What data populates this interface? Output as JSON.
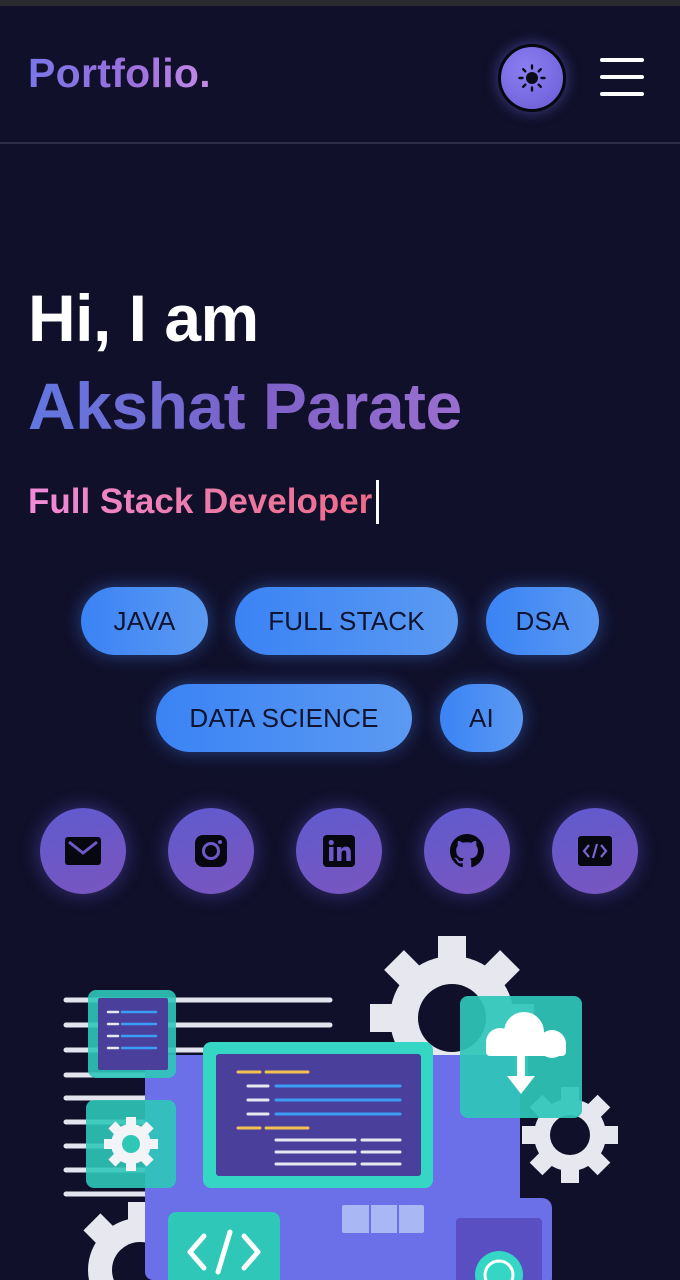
{
  "header": {
    "logo": "Portfolio.",
    "theme_toggle_icon": "sun-icon",
    "menu_icon": "hamburger-menu-icon"
  },
  "hero": {
    "greeting": "Hi, I am",
    "name": "Akshat Parate",
    "role": "Full Stack Developer"
  },
  "tags": [
    "JAVA",
    "FULL STACK",
    "DSA",
    "DATA SCIENCE",
    "AI"
  ],
  "socials": [
    {
      "icon": "mail-icon"
    },
    {
      "icon": "instagram-icon"
    },
    {
      "icon": "linkedin-icon"
    },
    {
      "icon": "github-icon"
    },
    {
      "icon": "code-icon"
    }
  ],
  "illustration": {
    "icon": "developer-workspace-illustration"
  },
  "colors": {
    "background": "#10102a",
    "accent_purple": "#7f62c8",
    "accent_pink": "#ec7aa7",
    "tag_blue": "#3b83f5"
  }
}
